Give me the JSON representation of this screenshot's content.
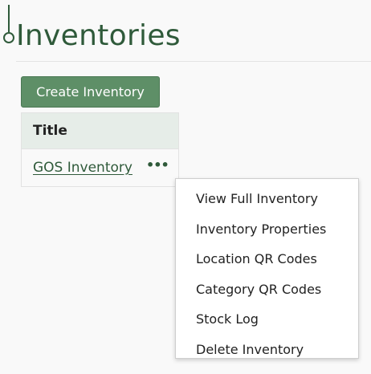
{
  "page": {
    "title": "Inventories"
  },
  "toolbar": {
    "create_label": "Create Inventory"
  },
  "table": {
    "header_title": "Title",
    "rows": [
      {
        "title": "GOS Inventory",
        "actions_icon": "ellipsis-icon",
        "actions_label": "•••"
      }
    ]
  },
  "context_menu": {
    "items": [
      {
        "label": "View Full Inventory"
      },
      {
        "label": "Inventory Properties"
      },
      {
        "label": "Location QR Codes"
      },
      {
        "label": "Category QR Codes"
      },
      {
        "label": "Stock Log"
      },
      {
        "label": "Delete Inventory"
      }
    ]
  },
  "colors": {
    "brand_green": "#2f5a3a",
    "button_green": "#5e8f67",
    "header_bg": "#e6ede8"
  }
}
